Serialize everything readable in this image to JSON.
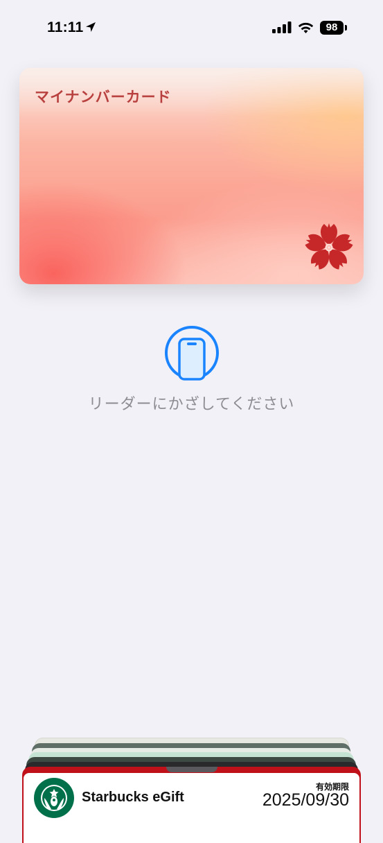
{
  "status_bar": {
    "time": "11:11",
    "battery": "98",
    "icons": [
      "location-arrow-icon",
      "cellular-signal-icon",
      "wifi-icon",
      "battery-icon"
    ]
  },
  "wallet_card": {
    "title": "マイナンバーカード",
    "emblem": "sakura-flower-icon",
    "colors": {
      "title": "#b8403e",
      "emblem": "#c6282a"
    }
  },
  "reader_prompt": {
    "icon": "phone-nfc-icon",
    "text": "リーダーにかざしてください",
    "accent": "#1a84ff"
  },
  "stacked_pass": {
    "logo": "starbucks-logo",
    "name": "Starbucks eGift",
    "expiry_label": "有効期限",
    "expiry_value": "2025/09/30",
    "colors": {
      "border": "#c0101a",
      "logo": "#00704a"
    }
  }
}
